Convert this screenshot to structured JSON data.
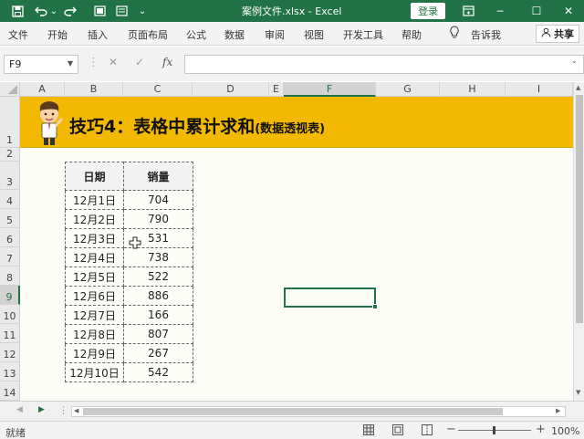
{
  "window": {
    "title": "案例文件.xlsx  -  Excel",
    "login_label": "登录",
    "controls": {
      "minimize": "─",
      "restore": "☐",
      "close": "✕"
    }
  },
  "quick_access": {
    "save": "save-icon",
    "undo": "undo-icon",
    "undo_arrow": "⌄",
    "redo": "redo-icon",
    "view": "view-icon",
    "touch": "touch-icon",
    "customize": "⌄"
  },
  "menu": {
    "items": [
      "文件",
      "开始",
      "插入",
      "页面布局",
      "公式",
      "数据",
      "审阅",
      "视图",
      "开发工具",
      "帮助"
    ],
    "tell_me": "告诉我",
    "share": "共享"
  },
  "formula_bar": {
    "name_box": "F9",
    "cancel": "✕",
    "enter": "✓",
    "fx": "fx",
    "value": ""
  },
  "columns": [
    "A",
    "B",
    "C",
    "D",
    "E",
    "F",
    "G",
    "H",
    "I"
  ],
  "active_column": "F",
  "rows": [
    "1",
    "2",
    "3",
    "4",
    "5",
    "6",
    "7",
    "8",
    "9",
    "10",
    "11",
    "12",
    "13",
    "14"
  ],
  "active_row": "9",
  "banner": {
    "title": "技巧4：表格中累计求和",
    "subtitle": "(数据透视表)"
  },
  "table": {
    "headers": [
      "日期",
      "销量"
    ],
    "rows": [
      [
        "12月1日",
        "704"
      ],
      [
        "12月2日",
        "790"
      ],
      [
        "12月3日",
        "531"
      ],
      [
        "12月4日",
        "738"
      ],
      [
        "12月5日",
        "522"
      ],
      [
        "12月6日",
        "886"
      ],
      [
        "12月7日",
        "166"
      ],
      [
        "12月8日",
        "807"
      ],
      [
        "12月9日",
        "267"
      ],
      [
        "12月10日",
        "542"
      ]
    ]
  },
  "status": {
    "ready": "就绪",
    "zoom": "100%",
    "zoom_minus": "−",
    "zoom_plus": "+"
  },
  "colors": {
    "excel_green": "#217346",
    "banner": "#f3b800"
  }
}
